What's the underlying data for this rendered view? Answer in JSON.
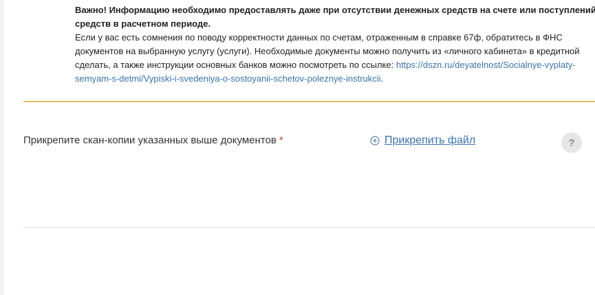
{
  "notice": {
    "bold_line_1": "Важно! Информацию необходимо предоставлять даже при отсутствии денежных средств на счете или поступлений",
    "bold_line_2": "средств в расчетном периоде.",
    "line_3": "Если у вас есть сомнения по поводу корректности данных по счетам, отраженным в справке 67ф, обратитесь в ФНС",
    "line_4": "документов на выбранную услугу (услуги). Необходимые документы можно получить из «личного кабинета» в кредитной",
    "line_5_text": "сделать, а также инструкции основных банков можно посмотреть по ссылке: ",
    "line_5_link": "https://dszn.ru/deyatelnost/Socialnye-vyplaty-",
    "line_6_link": "semyam-s-detmi/Vypiski-i-svedeniya-o-sostoyanii-schetov-poleznye-instrukcii",
    "line_6_tail": "."
  },
  "upload_field": {
    "label": "Прикрепите скан-копии указанных выше документов",
    "required_mark": "*",
    "attach_label": "Прикрепить файл",
    "attach_icon": "plus-circle-icon",
    "help_label": "?"
  },
  "colors": {
    "link": "#3a73a8",
    "required": "#e03c31",
    "gold_divider": "#e2bf63",
    "grey_divider": "#dddddd",
    "help_bg": "#e6e6e6"
  }
}
